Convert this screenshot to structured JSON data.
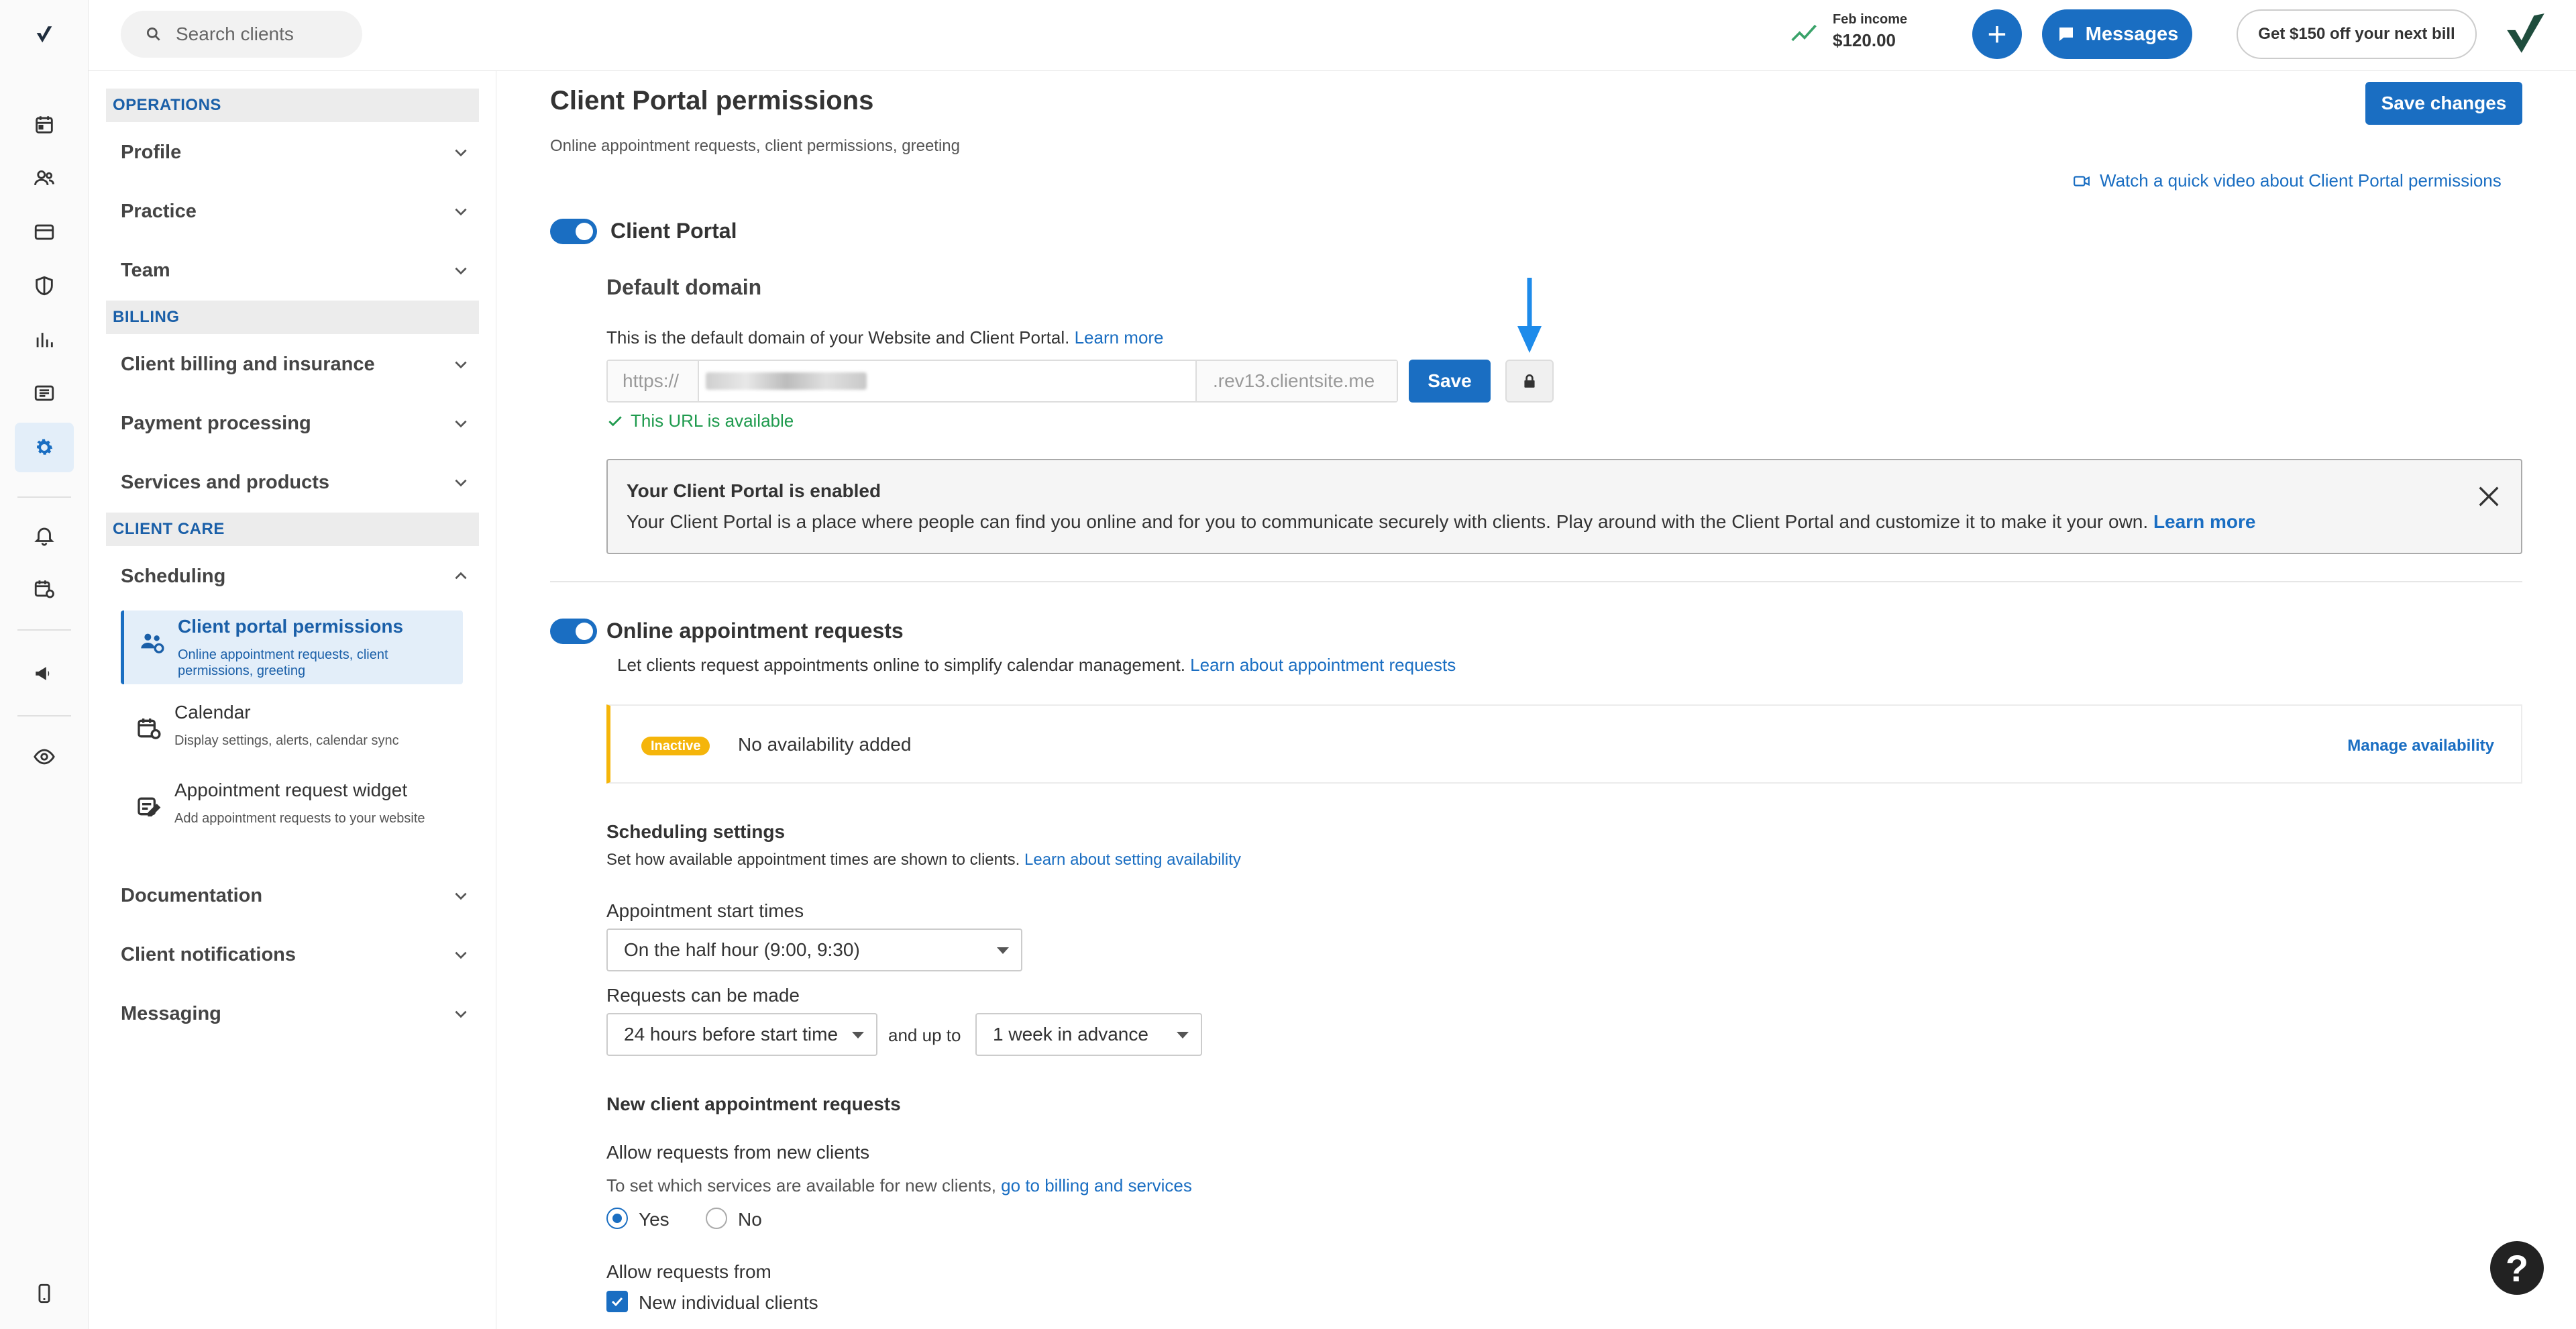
{
  "topbar": {
    "search_placeholder": "Search clients",
    "income_label": "Feb income",
    "income_value": "$120.00",
    "plus_label": "+",
    "messages_label": "Messages",
    "promo_label": "Get $150 off your next bill"
  },
  "sidenav": {
    "sections": {
      "operations": "OPERATIONS",
      "billing": "BILLING",
      "client_care": "CLIENT CARE"
    },
    "items": {
      "profile": "Profile",
      "practice": "Practice",
      "team": "Team",
      "client_billing": "Client billing and insurance",
      "payment_processing": "Payment processing",
      "services_products": "Services and products",
      "scheduling": "Scheduling",
      "documentation": "Documentation",
      "client_notifications": "Client notifications",
      "messaging": "Messaging"
    },
    "scheduling_sub": [
      {
        "title": "Client portal permissions",
        "desc1": "Online appointment requests, client",
        "desc2": "permissions, greeting"
      },
      {
        "title": "Calendar",
        "desc1": "Display settings, alerts, calendar sync",
        "desc2": ""
      },
      {
        "title": "Appointment request widget",
        "desc1": "Add appointment requests to your website",
        "desc2": ""
      }
    ]
  },
  "main": {
    "title": "Client Portal permissions",
    "subtitle": "Online appointment requests, client permissions, greeting",
    "save_changes": "Save changes",
    "video_link": "Watch a quick video about Client Portal permissions",
    "client_portal": {
      "label": "Client Portal",
      "default_domain_heading": "Default domain",
      "domain_desc": "This is the default domain of your Website and Client Portal.",
      "learn_more": "Learn more",
      "url_prefix": "https://",
      "url_suffix": ".rev13.clientsite.me",
      "save_label": "Save",
      "available_msg": "This URL is available",
      "enabled_title": "Your Client Portal is enabled",
      "enabled_body": "Your Client Portal is a place where people can find you online and for you to communicate securely with clients. Play around with the Client Portal and customize it to make it your own.",
      "enabled_learn_more": "Learn more"
    },
    "online_requests": {
      "label": "Online appointment requests",
      "desc": "Let clients request appointments online to simplify calendar management.",
      "desc_link": "Learn about appointment requests",
      "badge": "Inactive",
      "no_availability": "No availability added",
      "manage_availability": "Manage availability"
    },
    "scheduling_settings": {
      "heading": "Scheduling settings",
      "desc": "Set how available appointment times are shown to clients.",
      "desc_link": "Learn about setting availability",
      "start_times_label": "Appointment start times",
      "start_times_value": "On the half hour (9:00, 9:30)",
      "requests_label": "Requests can be made",
      "requests_min_value": "24 hours before start time",
      "and_up_to": "and up to",
      "requests_max_value": "1 week in advance"
    },
    "new_client_requests": {
      "heading": "New client appointment requests",
      "allow_label": "Allow requests from new clients",
      "services_desc": "To set which services are available for new clients,",
      "services_link": "go to billing and services",
      "yes": "Yes",
      "no": "No",
      "allow_from_label": "Allow requests from",
      "new_individual": "New individual clients"
    }
  },
  "help_label": "?",
  "colors": {
    "accent": "#1a6ec2",
    "inactive": "#f5b50a",
    "success": "#1e9a4d"
  }
}
